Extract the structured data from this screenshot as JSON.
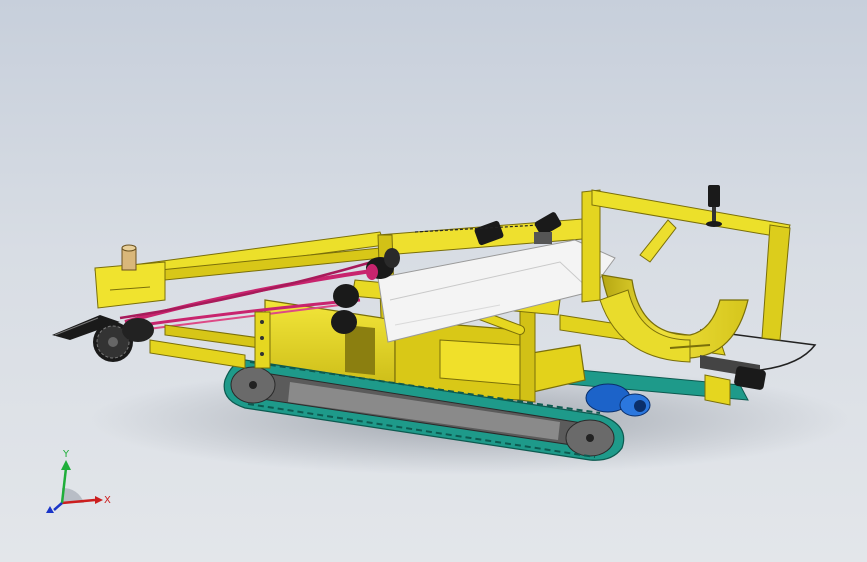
{
  "triad": {
    "x_label": "X",
    "y_label": "Y",
    "x_color": "#cc1e1e",
    "y_color": "#1fae3a",
    "z_color": "#1a35c8"
  },
  "colors": {
    "frame": "#e8d81a",
    "frame_dark": "#8f8410",
    "track": "#1e9a8a",
    "track_plate": "#4a4a4a",
    "belt": "#c8246e",
    "sheet": "#f4f4f4",
    "motor": "#1a1a1a",
    "gearbox": "#1c63c9"
  }
}
